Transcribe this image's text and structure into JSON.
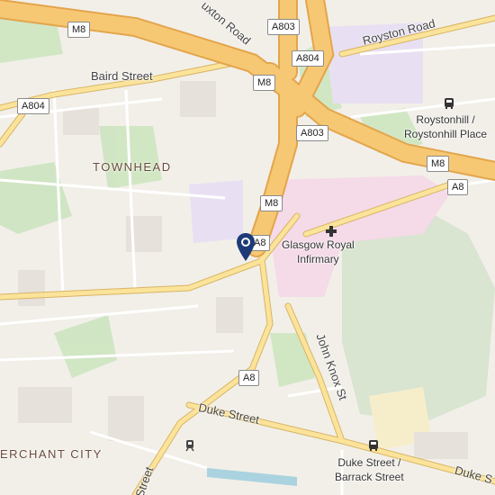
{
  "map": {
    "areas": {
      "townhead": "TOWNHEAD",
      "merchant_city": "ERCHANT CITY"
    },
    "streets": {
      "royston_road": "Royston Road",
      "baird_street": "Baird Street",
      "duke_street": "Duke Street",
      "duke_street_right": "Duke S",
      "john_knox": "John Knox St",
      "castle_street": "Castle Street",
      "cuxton_road": "uxton Road",
      "street_bottom": "Street"
    },
    "shields": {
      "m8_top": "M8",
      "m8_mid": "M8",
      "m8_lower": "M8",
      "m8_right": "M8",
      "a803_top": "A803",
      "a803_mid": "A803",
      "a804_top": "A804",
      "a804_left": "A804",
      "a8_right": "A8",
      "a8_bottom": "A8",
      "a8_marker": "A8"
    },
    "poi": {
      "royal_infirmary": "Glasgow Royal\nInfirmary",
      "roystonhill": "Roystonhill /\nRoystonhill Place",
      "duke_barrack": "Duke Street /\nBarrack Street"
    },
    "icons": [
      "hospital-cross-icon",
      "bus-stop-icon",
      "train-station-icon",
      "location-pin-icon"
    ],
    "colors": {
      "motorway": "#f7c873",
      "motorway_casing": "#e3a54c",
      "park": "#cfe5c3",
      "hospital": "#f3d9e6",
      "water": "#aad3df"
    }
  }
}
